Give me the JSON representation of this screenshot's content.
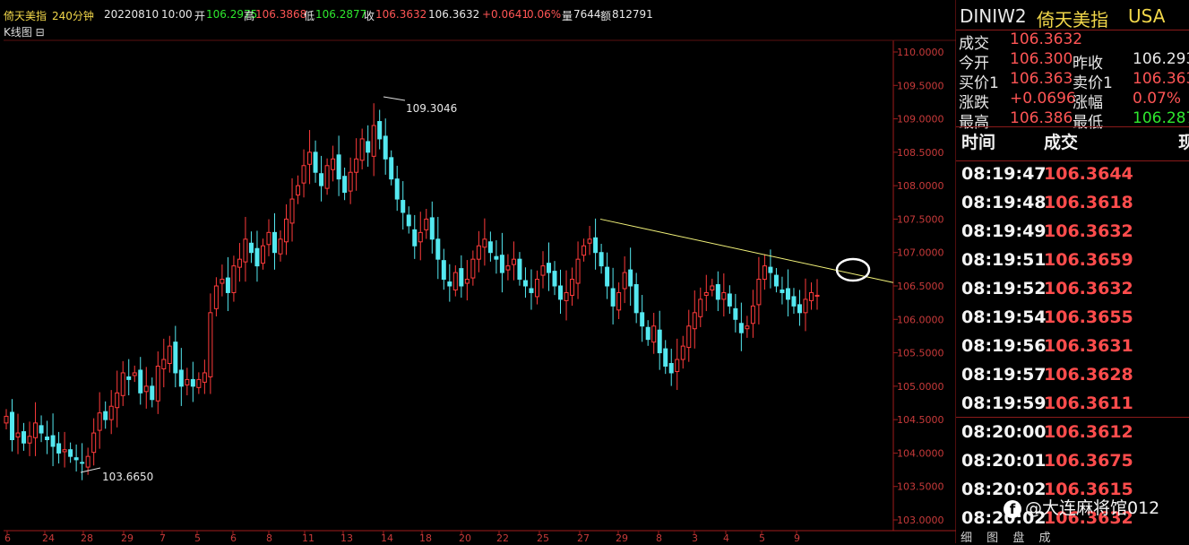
{
  "header": {
    "title": "倚天美指",
    "period": "240分钟",
    "date": "20220810",
    "time": "10:00",
    "open_label": "开",
    "open_value": "106.2975",
    "high_label": "高",
    "high_value": "106.3868",
    "low_label": "低",
    "low_value": "106.2877",
    "close_label": "收",
    "close_value": "106.3632",
    "last_value": "106.3632",
    "change": "+0.0641",
    "change_pct": "0.06%",
    "volume_label": "量",
    "volume_value": "7644",
    "amount_label": "额",
    "amount_value": "812791"
  },
  "chart_label": "K线图 ⊟",
  "chart_data": {
    "type": "candlestick",
    "ylim": [
      102.9,
      110.4
    ],
    "yticks": [
      "110.0000",
      "109.5000",
      "109.0000",
      "108.5000",
      "108.0000",
      "107.5000",
      "107.0000",
      "106.5000",
      "106.0000",
      "105.5000",
      "105.0000",
      "104.5000",
      "104.0000",
      "103.5000",
      "103.0000"
    ],
    "xticks": [
      "6",
      "24",
      "28",
      "29",
      "7",
      "5",
      "6",
      "8",
      "11",
      "13",
      "14",
      "18",
      "20",
      "22",
      "25",
      "27",
      "29",
      "8",
      "3",
      "4",
      "5",
      "9"
    ],
    "annotations": [
      "109.3046",
      "103.6650"
    ],
    "closes": [
      104.55,
      104.2,
      104.3,
      104.15,
      104.25,
      104.45,
      104.3,
      104.2,
      104.1,
      104.0,
      104.05,
      103.95,
      103.9,
      103.85,
      103.95,
      104.3,
      104.6,
      104.5,
      104.7,
      104.9,
      105.2,
      105.1,
      105.2,
      104.9,
      105.0,
      104.8,
      105.3,
      105.4,
      105.6,
      105.2,
      105.0,
      105.1,
      105.0,
      105.1,
      105.2,
      106.1,
      106.5,
      106.6,
      106.4,
      106.8,
      106.9,
      107.2,
      107.0,
      106.8,
      107.1,
      107.3,
      107.0,
      107.2,
      107.5,
      107.8,
      108.0,
      108.3,
      108.5,
      108.2,
      108.0,
      108.3,
      108.4,
      108.1,
      107.9,
      108.2,
      108.4,
      108.7,
      108.5,
      108.9,
      108.7,
      108.4,
      108.1,
      107.8,
      107.6,
      107.4,
      107.1,
      107.3,
      107.5,
      107.2,
      106.9,
      106.6,
      106.5,
      106.7,
      106.5,
      106.6,
      106.9,
      107.1,
      107.2,
      107.0,
      106.9,
      106.7,
      106.8,
      106.9,
      106.6,
      106.5,
      106.4,
      106.6,
      106.8,
      106.7,
      106.5,
      106.3,
      106.4,
      106.6,
      106.9,
      107.1,
      107.2,
      107.0,
      106.8,
      106.5,
      106.2,
      106.4,
      106.7,
      106.5,
      106.1,
      105.9,
      105.7,
      105.9,
      105.5,
      105.3,
      105.2,
      105.4,
      105.6,
      105.9,
      106.1,
      106.3,
      106.4,
      106.5,
      106.3,
      106.4,
      106.2,
      106.0,
      105.8,
      105.9,
      106.2,
      106.6,
      106.8,
      106.7,
      106.5,
      106.4,
      106.3,
      106.2,
      106.1,
      106.3,
      106.4,
      106.36
    ]
  },
  "panel": {
    "code": "DINIW2",
    "name": "倚天美指",
    "market": "USA",
    "quotes": [
      {
        "l1": "成交",
        "v1": "106.3632",
        "l2": "",
        "v2": ""
      },
      {
        "l1": "今开",
        "v1": "106.300",
        "l2": "昨收",
        "v2": "106.293"
      },
      {
        "l1": "买价1",
        "v1": "106.363",
        "l2": "卖价1",
        "v2": "106.363"
      },
      {
        "l1": "涨跌",
        "v1": "+0.0696",
        "l2": "涨幅",
        "v2": "0.07%"
      },
      {
        "l1": "最高",
        "v1": "106.386",
        "l2": "最低",
        "v2": "106.287"
      }
    ],
    "trade_header_time": "时间",
    "trade_header_price": "成交",
    "trade_header_extra": "现",
    "trades": [
      {
        "time": "08:19:47",
        "price": "106.3644"
      },
      {
        "time": "08:19:48",
        "price": "106.3618"
      },
      {
        "time": "08:19:49",
        "price": "106.3632"
      },
      {
        "time": "08:19:51",
        "price": "106.3659"
      },
      {
        "time": "08:19:52",
        "price": "106.3632"
      },
      {
        "time": "08:19:54",
        "price": "106.3655"
      },
      {
        "time": "08:19:56",
        "price": "106.3631"
      },
      {
        "time": "08:19:57",
        "price": "106.3628"
      },
      {
        "time": "08:19:59",
        "price": "106.3611"
      },
      {
        "time": "08:20:00",
        "price": "106.3612"
      },
      {
        "time": "08:20:01",
        "price": "106.3675"
      },
      {
        "time": "08:20:02",
        "price": "106.3615"
      },
      {
        "time": "08:20:02",
        "price": "106.3632"
      }
    ],
    "tabs": [
      "细",
      "图",
      "盘",
      "成"
    ],
    "watermark": "@大连麻将馆012",
    "watermark_icon": "f"
  }
}
